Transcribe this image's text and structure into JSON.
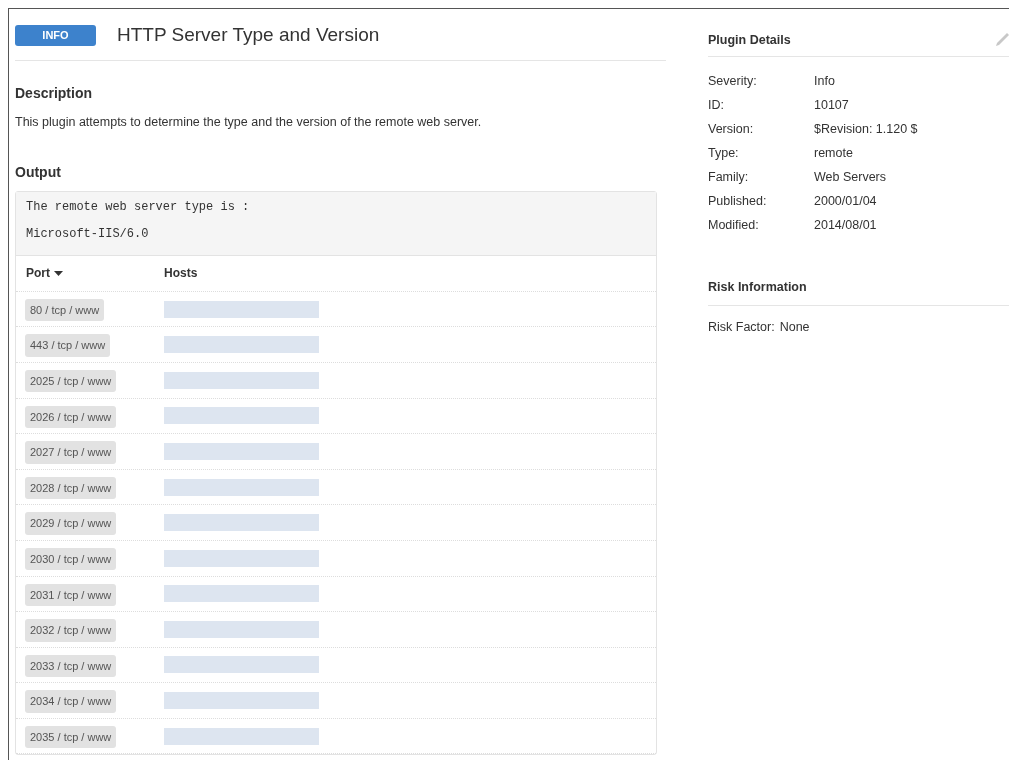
{
  "header": {
    "severity_badge": "INFO",
    "title": "HTTP Server Type and Version"
  },
  "description": {
    "heading": "Description",
    "text": "This plugin attempts to determine the type and the version of the remote web server."
  },
  "output": {
    "heading": "Output",
    "lines": [
      "The remote web server type is :",
      "Microsoft-IIS/6.0"
    ],
    "table": {
      "columns": [
        {
          "label": "Port",
          "sorted": true
        },
        {
          "label": "Hosts",
          "sorted": false
        }
      ],
      "rows": [
        {
          "port": "80 / tcp / www"
        },
        {
          "port": "443 / tcp / www"
        },
        {
          "port": "2025 / tcp / www"
        },
        {
          "port": "2026 / tcp / www"
        },
        {
          "port": "2027 / tcp / www"
        },
        {
          "port": "2028 / tcp / www"
        },
        {
          "port": "2029 / tcp / www"
        },
        {
          "port": "2030 / tcp / www"
        },
        {
          "port": "2031 / tcp / www"
        },
        {
          "port": "2032 / tcp / www"
        },
        {
          "port": "2033 / tcp / www"
        },
        {
          "port": "2034 / tcp / www"
        },
        {
          "port": "2035 / tcp / www"
        }
      ]
    }
  },
  "plugin_details": {
    "heading": "Plugin Details",
    "fields": [
      {
        "label": "Severity:",
        "value": "Info"
      },
      {
        "label": "ID:",
        "value": "10107"
      },
      {
        "label": "Version:",
        "value": "$Revision: 1.120 $"
      },
      {
        "label": "Type:",
        "value": "remote"
      },
      {
        "label": "Family:",
        "value": "Web Servers"
      },
      {
        "label": "Published:",
        "value": "2000/01/04"
      },
      {
        "label": "Modified:",
        "value": "2014/08/01"
      }
    ]
  },
  "risk_information": {
    "heading": "Risk Information",
    "label": "Risk Factor:",
    "value": "None"
  }
}
